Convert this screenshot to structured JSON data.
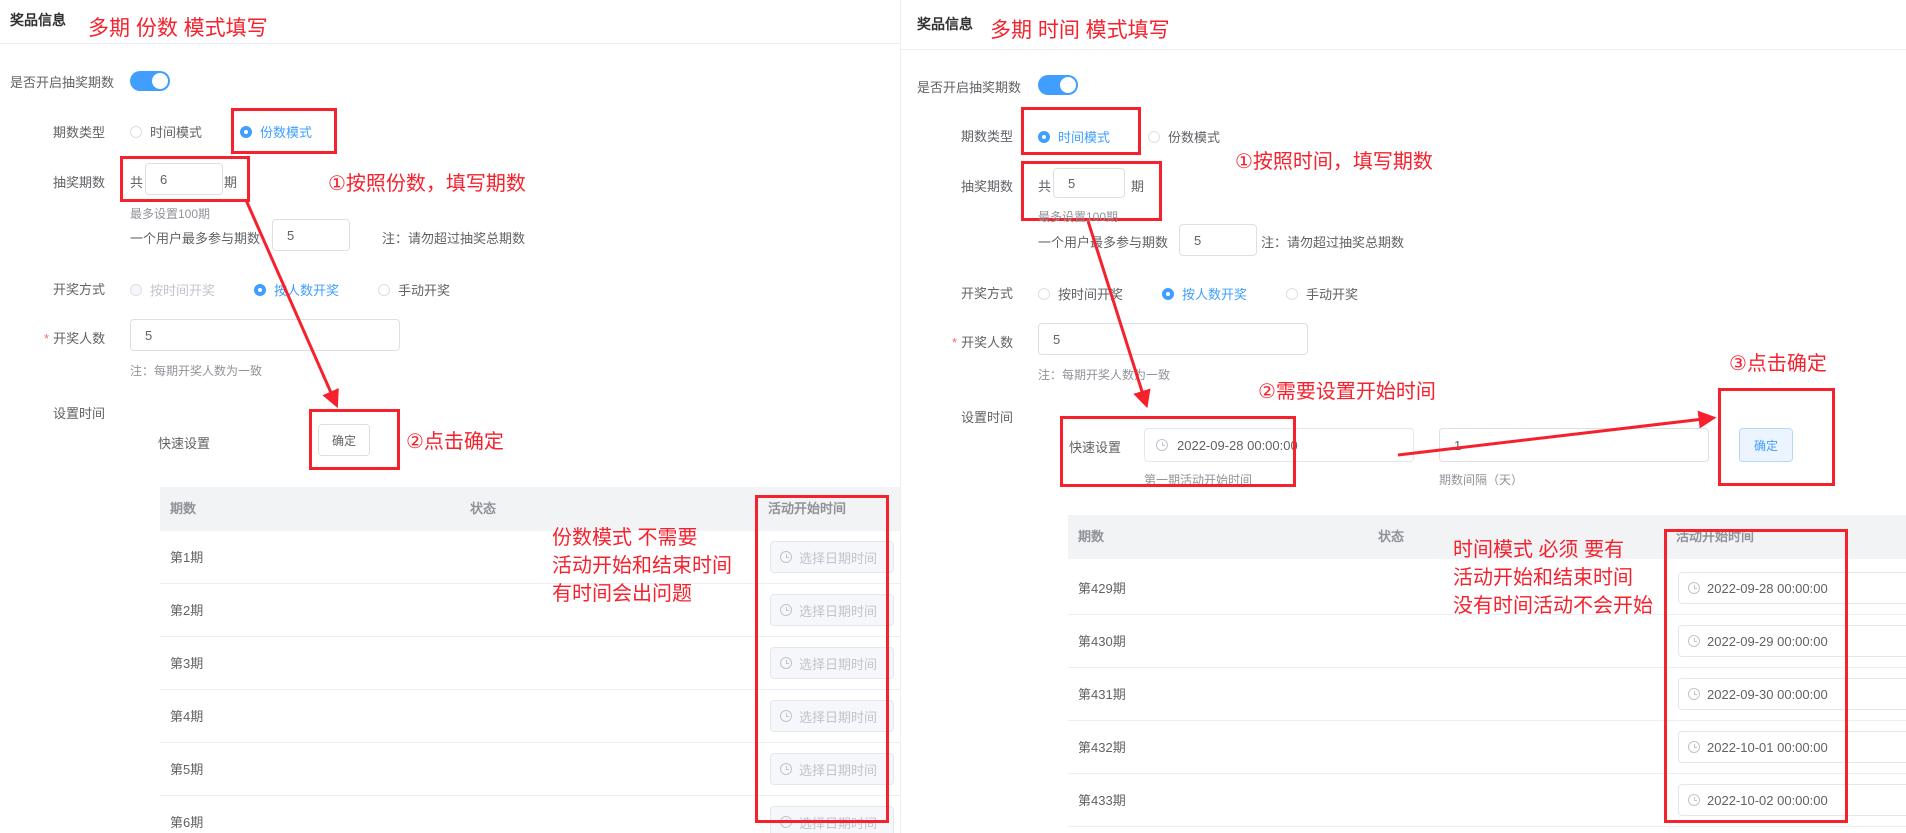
{
  "left": {
    "section_title": "奖品信息",
    "annotation_title": "多期 份数 模式填写",
    "enable_label": "是否开启抽奖期数",
    "period_type_label": "期数类型",
    "radio_time": "时间模式",
    "radio_count": "份数模式",
    "lottery_periods_label": "抽奖期数",
    "gong": "共",
    "qi": "期",
    "periods_value": "6",
    "max_hint": "最多设置100期",
    "max_user_label": "一个用户最多参与期数",
    "max_user_value": "5",
    "max_user_note": "注：请勿超过抽奖总期数",
    "draw_method_label": "开奖方式",
    "draw_by_time": "按时间开奖",
    "draw_by_people": "按人数开奖",
    "draw_manual": "手动开奖",
    "draw_people_label": "开奖人数",
    "draw_people_value": "5",
    "draw_people_note": "注：每期开奖人数为一致",
    "set_time_label": "设置时间",
    "quick_set_label": "快速设置",
    "confirm": "确定",
    "anno_step1": "①按照份数，填写期数",
    "anno_step2": "②点击确定",
    "anno_note": [
      "份数模式 不需要",
      "活动开始和结束时间",
      "有时间会出问题"
    ],
    "table_headers": [
      "期数",
      "状态",
      "活动开始时间"
    ],
    "rows": [
      {
        "period": "第1期",
        "time": "选择日期时间"
      },
      {
        "period": "第2期",
        "time": "选择日期时间"
      },
      {
        "period": "第3期",
        "time": "选择日期时间"
      },
      {
        "period": "第4期",
        "time": "选择日期时间"
      },
      {
        "period": "第5期",
        "time": "选择日期时间"
      },
      {
        "period": "第6期",
        "time": "选择日期时间"
      }
    ]
  },
  "right": {
    "section_title": "奖品信息",
    "annotation_title": "多期 时间 模式填写",
    "enable_label": "是否开启抽奖期数",
    "period_type_label": "期数类型",
    "radio_time": "时间模式",
    "radio_count": "份数模式",
    "lottery_periods_label": "抽奖期数",
    "gong": "共",
    "qi": "期",
    "periods_value": "5",
    "max_hint": "最多设置100期",
    "max_user_label": "一个用户最多参与期数",
    "max_user_value": "5",
    "max_user_note": "注：请勿超过抽奖总期数",
    "draw_method_label": "开奖方式",
    "draw_by_time": "按时间开奖",
    "draw_by_people": "按人数开奖",
    "draw_manual": "手动开奖",
    "draw_people_label": "开奖人数",
    "draw_people_value": "5",
    "draw_people_note": "注：每期开奖人数为一致",
    "set_time_label": "设置时间",
    "quick_set_label": "快速设置",
    "start_time_value": "2022-09-28 00:00:00",
    "start_time_hint": "第一期活动开始时间",
    "interval_value": "1",
    "interval_hint": "期数间隔（天）",
    "confirm": "确定",
    "anno_step1": "①按照时间，填写期数",
    "anno_step2": "②需要设置开始时间",
    "anno_step3": "③点击确定",
    "anno_note": [
      "时间模式 必须 要有",
      "活动开始和结束时间",
      "没有时间活动不会开始"
    ],
    "table_headers": [
      "期数",
      "状态",
      "活动开始时间"
    ],
    "rows": [
      {
        "period": "第429期",
        "time": "2022-09-28 00:00:00"
      },
      {
        "period": "第430期",
        "time": "2022-09-29 00:00:00"
      },
      {
        "period": "第431期",
        "time": "2022-09-30 00:00:00"
      },
      {
        "period": "第432期",
        "time": "2022-10-01 00:00:00"
      },
      {
        "period": "第433期",
        "time": "2022-10-02 00:00:00"
      }
    ]
  },
  "colors": {
    "annotation": "#f5222d",
    "primary": "#409eff"
  }
}
